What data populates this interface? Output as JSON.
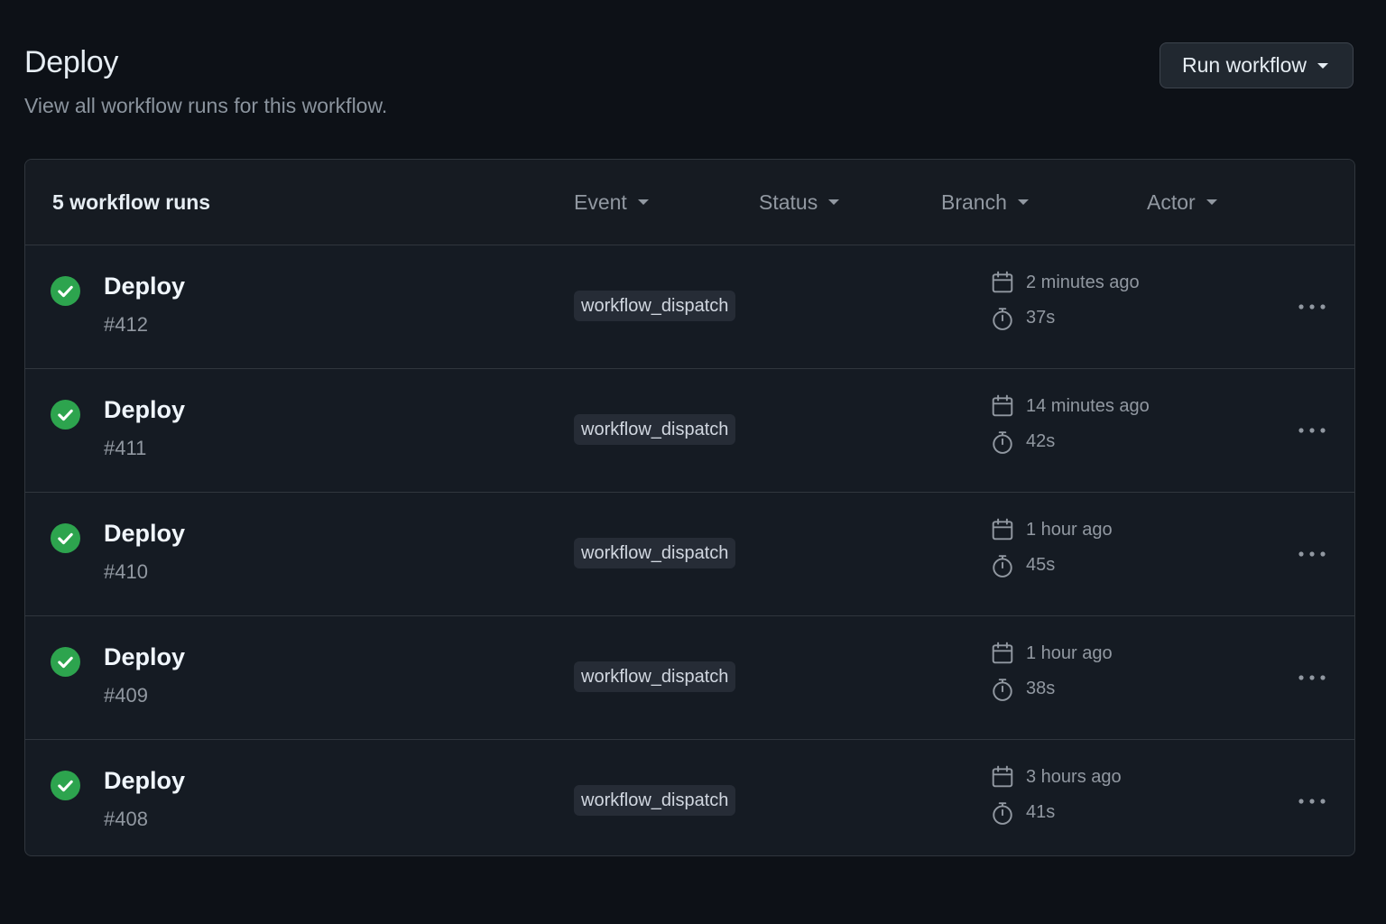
{
  "header": {
    "title": "Deploy",
    "subtitle": "View all workflow runs for this workflow.",
    "run_button_label": "Run workflow"
  },
  "table": {
    "count_label": "5 workflow runs",
    "filters": [
      "Event",
      "Status",
      "Branch",
      "Actor"
    ],
    "runs": [
      {
        "name": "Deploy",
        "number": "#412",
        "event": "workflow_dispatch",
        "time": "2 minutes ago",
        "duration": "37s",
        "status": "success"
      },
      {
        "name": "Deploy",
        "number": "#411",
        "event": "workflow_dispatch",
        "time": "14 minutes ago",
        "duration": "42s",
        "status": "success"
      },
      {
        "name": "Deploy",
        "number": "#410",
        "event": "workflow_dispatch",
        "time": "1 hour ago",
        "duration": "45s",
        "status": "success"
      },
      {
        "name": "Deploy",
        "number": "#409",
        "event": "workflow_dispatch",
        "time": "1 hour ago",
        "duration": "38s",
        "status": "success"
      },
      {
        "name": "Deploy",
        "number": "#408",
        "event": "workflow_dispatch",
        "time": "3 hours ago",
        "duration": "41s",
        "status": "success"
      }
    ]
  },
  "icons": {
    "status": "check-circle-icon",
    "time": "calendar-icon",
    "duration": "stopwatch-icon",
    "more": "kebab-horizontal-icon",
    "dropdown": "caret-down-icon"
  },
  "colors": {
    "background": "#0d1117",
    "success": "#2da44e",
    "border": "#30363d",
    "muted_text": "#9198a1"
  }
}
